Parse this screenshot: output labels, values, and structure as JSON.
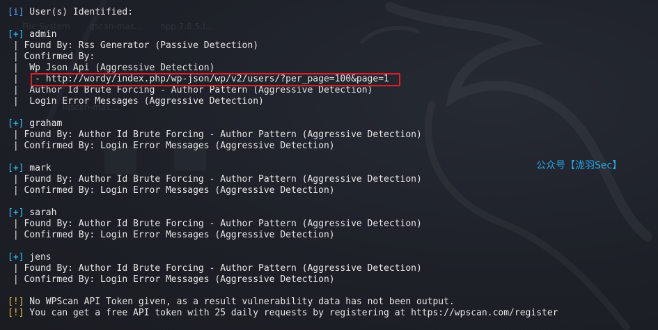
{
  "colors": {
    "background": "#1c1f26",
    "text": "#e6e6e6",
    "info_tag": "#5aa8ff",
    "plus_tag": "#39c5ff",
    "warn_tag": "#e8c341",
    "highlight_border": "#e11d2a",
    "watermark": "#29a8e6"
  },
  "ghost_labels": {
    "file_system": "File System",
    "qscan": "qscan-mas...",
    "npp": "npp.7.8.5.I...",
    "lqscan": "lqscan-mas..."
  },
  "terminal": {
    "header": {
      "tag": "[i]",
      "text": " User(s) Identified:"
    },
    "users": [
      {
        "tag": "[+]",
        "name": " admin",
        "details": [
          " | Found By: Rss Generator (Passive Detection)",
          " | Confirmed By:",
          " |  Wp Json Api (Aggressive Detection)",
          " |   - http://wordy/index.php/wp-json/wp/v2/users/?per_page=100&page=1",
          " |  Author Id Brute Forcing - Author Pattern (Aggressive Detection)",
          " |  Login Error Messages (Aggressive Detection)"
        ]
      },
      {
        "tag": "[+]",
        "name": " graham",
        "details": [
          " | Found By: Author Id Brute Forcing - Author Pattern (Aggressive Detection)",
          " | Confirmed By: Login Error Messages (Aggressive Detection)"
        ]
      },
      {
        "tag": "[+]",
        "name": " mark",
        "details": [
          " | Found By: Author Id Brute Forcing - Author Pattern (Aggressive Detection)",
          " | Confirmed By: Login Error Messages (Aggressive Detection)"
        ]
      },
      {
        "tag": "[+]",
        "name": " sarah",
        "details": [
          " | Found By: Author Id Brute Forcing - Author Pattern (Aggressive Detection)",
          " | Confirmed By: Login Error Messages (Aggressive Detection)"
        ]
      },
      {
        "tag": "[+]",
        "name": " jens",
        "details": [
          " | Found By: Author Id Brute Forcing - Author Pattern (Aggressive Detection)",
          " | Confirmed By: Login Error Messages (Aggressive Detection)"
        ]
      }
    ],
    "warnings": [
      {
        "tag": "[!]",
        "text": " No WPScan API Token given, as a result vulnerability data has not been output."
      },
      {
        "tag": "[!]",
        "text": " You can get a free API token with 25 daily requests by registering at https://wpscan.com/register"
      }
    ]
  },
  "watermark": "公众号【泷羽Sec】"
}
